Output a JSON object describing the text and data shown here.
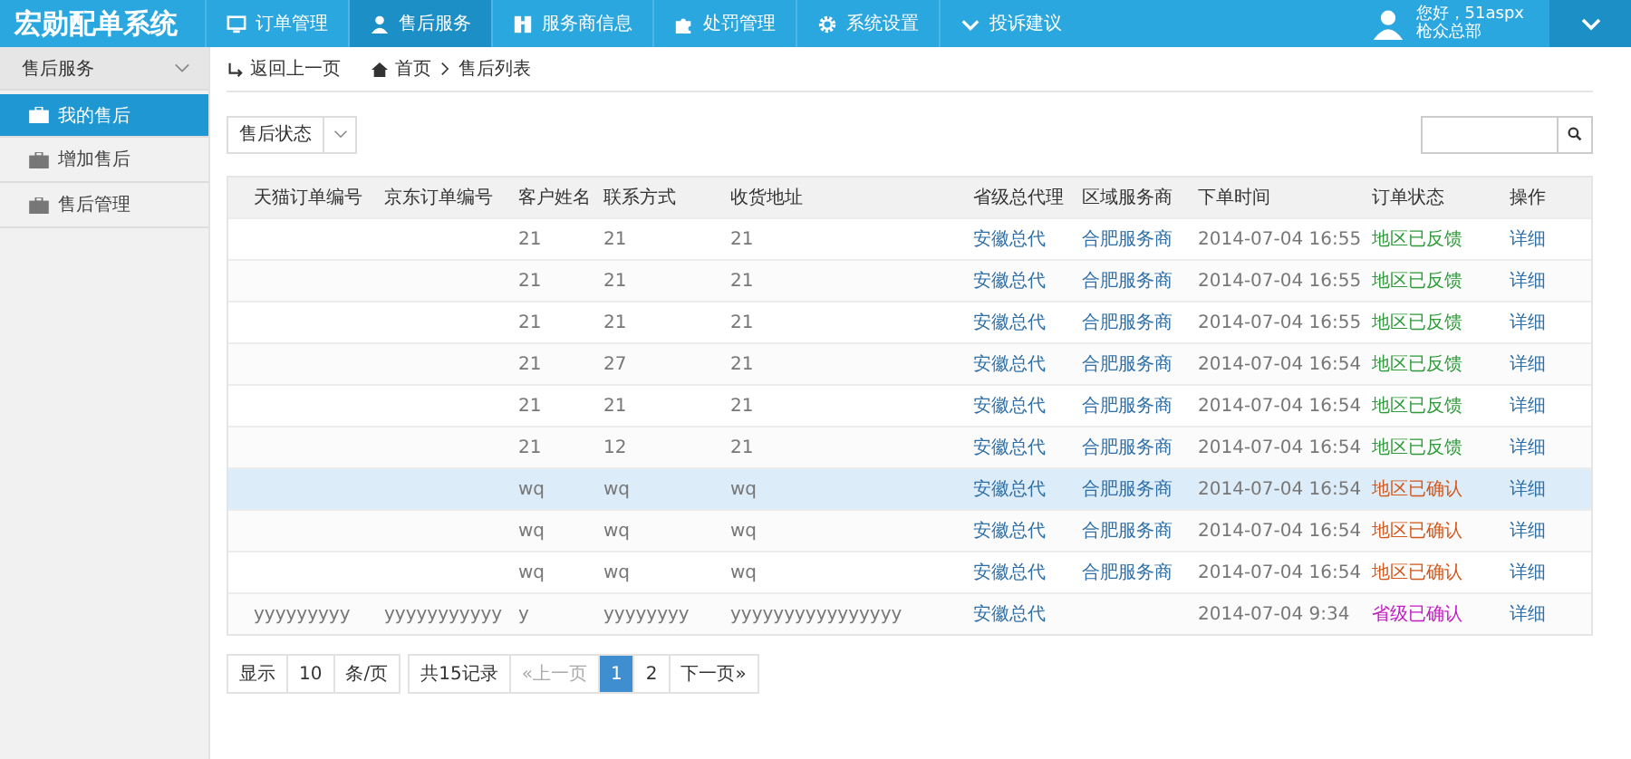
{
  "app_title": "宏勋配单系统",
  "nav": {
    "items": [
      {
        "label": "订单管理",
        "selected": false
      },
      {
        "label": "售后服务",
        "selected": true
      },
      {
        "label": "服务商信息",
        "selected": false
      },
      {
        "label": "处罚管理",
        "selected": false
      },
      {
        "label": "系统设置",
        "selected": false
      },
      {
        "label": "投诉建议",
        "selected": false
      }
    ]
  },
  "user": {
    "greeting": "您好，51aspx",
    "org": "枪众总部"
  },
  "sidebar": {
    "section": {
      "label": "售后服务",
      "expanded": true
    },
    "items": [
      {
        "label": "我的售后",
        "selected": true
      },
      {
        "label": "增加售后",
        "selected": false
      },
      {
        "label": "售后管理",
        "selected": false
      }
    ]
  },
  "breadcrumb": {
    "back": "返回上一页",
    "home": "首页",
    "current": "售后列表"
  },
  "filter": {
    "label": "售后状态"
  },
  "table": {
    "columns": [
      "天猫订单编号",
      "京东订单编号",
      "客户姓名",
      "联系方式",
      "收货地址",
      "省级总代理",
      "区域服务商",
      "下单时间",
      "订单状态",
      "操作"
    ],
    "rows": [
      {
        "selected": false,
        "cells": [
          "",
          "",
          "21",
          "21",
          "21",
          "安徽总代",
          "合肥服务商",
          "2014-07-04 16:55"
        ],
        "status": {
          "text": "地区已反馈",
          "color": "#2e9b3a"
        },
        "action": "详细"
      },
      {
        "selected": false,
        "cells": [
          "",
          "",
          "21",
          "21",
          "21",
          "安徽总代",
          "合肥服务商",
          "2014-07-04 16:55"
        ],
        "status": {
          "text": "地区已反馈",
          "color": "#2e9b3a"
        },
        "action": "详细"
      },
      {
        "selected": false,
        "cells": [
          "",
          "",
          "21",
          "21",
          "21",
          "安徽总代",
          "合肥服务商",
          "2014-07-04 16:55"
        ],
        "status": {
          "text": "地区已反馈",
          "color": "#2e9b3a"
        },
        "action": "详细"
      },
      {
        "selected": false,
        "cells": [
          "",
          "",
          "21",
          "27",
          "21",
          "安徽总代",
          "合肥服务商",
          "2014-07-04 16:54"
        ],
        "status": {
          "text": "地区已反馈",
          "color": "#2e9b3a"
        },
        "action": "详细"
      },
      {
        "selected": false,
        "cells": [
          "",
          "",
          "21",
          "21",
          "21",
          "安徽总代",
          "合肥服务商",
          "2014-07-04 16:54"
        ],
        "status": {
          "text": "地区已反馈",
          "color": "#2e9b3a"
        },
        "action": "详细"
      },
      {
        "selected": false,
        "cells": [
          "",
          "",
          "21",
          "12",
          "21",
          "安徽总代",
          "合肥服务商",
          "2014-07-04 16:54"
        ],
        "status": {
          "text": "地区已反馈",
          "color": "#2e9b3a"
        },
        "action": "详细"
      },
      {
        "selected": true,
        "cells": [
          "",
          "",
          "wq",
          "wq",
          "wq",
          "安徽总代",
          "合肥服务商",
          "2014-07-04 16:54"
        ],
        "status": {
          "text": "地区已确认",
          "color": "#d2581b"
        },
        "action": "详细"
      },
      {
        "selected": false,
        "cells": [
          "",
          "",
          "wq",
          "wq",
          "wq",
          "安徽总代",
          "合肥服务商",
          "2014-07-04 16:54"
        ],
        "status": {
          "text": "地区已确认",
          "color": "#d2581b"
        },
        "action": "详细"
      },
      {
        "selected": false,
        "cells": [
          "",
          "",
          "wq",
          "wq",
          "wq",
          "安徽总代",
          "合肥服务商",
          "2014-07-04 16:54"
        ],
        "status": {
          "text": "地区已确认",
          "color": "#d2581b"
        },
        "action": "详细"
      },
      {
        "selected": false,
        "cells": [
          "yyyyyyyyy",
          "yyyyyyyyyyy",
          "y",
          "yyyyyyyy",
          "yyyyyyyyyyyyyyyy",
          "安徽总代",
          "",
          "2014-07-04 9:34"
        ],
        "status": {
          "text": "省级已确认",
          "color": "#c21bc4"
        },
        "action": "详细"
      }
    ]
  },
  "pagination": {
    "show_label": "显示",
    "page_size": "10",
    "per_page_label": "条/页",
    "total": "共15记录",
    "prev": "«上一页",
    "prev_disabled": true,
    "pages": [
      {
        "label": "1",
        "selected": true
      },
      {
        "label": "2",
        "selected": false
      }
    ],
    "next": "下一页»"
  }
}
